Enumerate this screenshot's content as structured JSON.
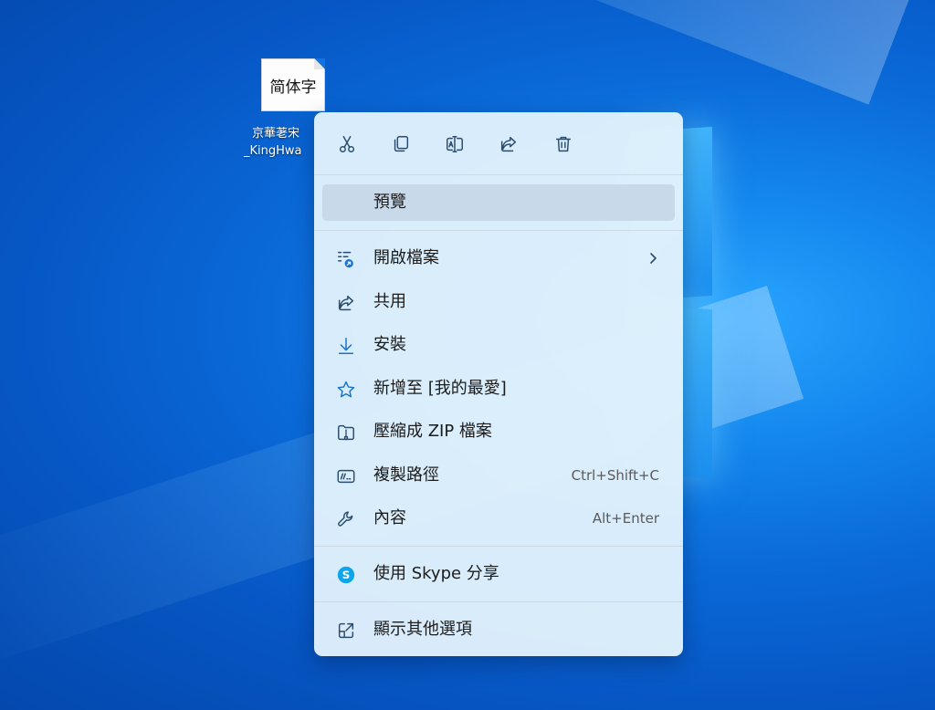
{
  "desktop": {
    "file": {
      "thumbnail_text": "简体字",
      "label_line1": "京華荖宋",
      "label_line2": "_KingHwa"
    }
  },
  "context_menu": {
    "toolbar": [
      {
        "name": "cut",
        "icon": "scissors-icon"
      },
      {
        "name": "copy",
        "icon": "copy-icon"
      },
      {
        "name": "rename",
        "icon": "rename-icon"
      },
      {
        "name": "share",
        "icon": "share-icon"
      },
      {
        "name": "delete",
        "icon": "trash-icon"
      }
    ],
    "items": {
      "preview": {
        "label": "預覽"
      },
      "open_with": {
        "label": "開啟檔案"
      },
      "share": {
        "label": "共用"
      },
      "install": {
        "label": "安裝"
      },
      "add_favorite": {
        "label": "新增至 [我的最愛]"
      },
      "compress_zip": {
        "label": "壓縮成 ZIP 檔案"
      },
      "copy_path": {
        "label": "複製路徑",
        "shortcut": "Ctrl+Shift+C"
      },
      "properties": {
        "label": "內容",
        "shortcut": "Alt+Enter"
      },
      "skype_share": {
        "label": "使用 Skype 分享"
      },
      "more_options": {
        "label": "顯示其他選項"
      }
    },
    "colors": {
      "background": "#e2f1fc",
      "accent": "#1a73c9",
      "skype": "#0ea5e9"
    }
  }
}
